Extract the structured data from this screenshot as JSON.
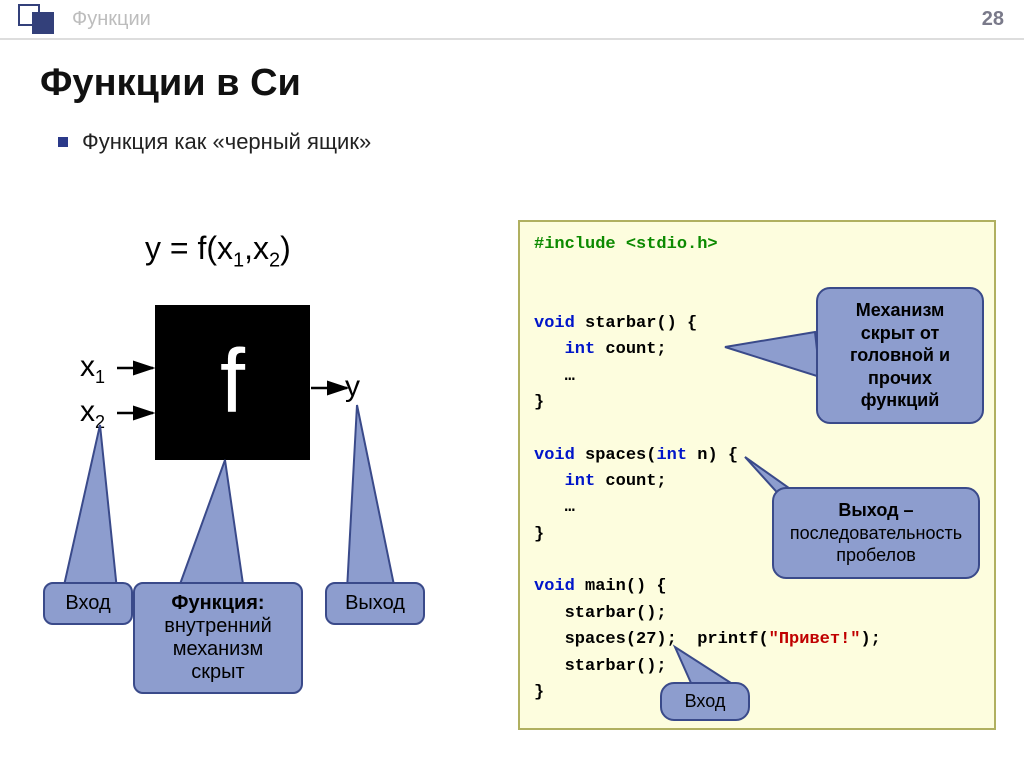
{
  "header": {
    "title": "Функции"
  },
  "page_number": "28",
  "main_title": "Функции в Си",
  "bullet": "Функция как «черный ящик»",
  "formula_html": "y = f(x<sub>1</sub>,x<sub>2</sub>)",
  "x1_html": "x<sub>1</sub>",
  "x2_html": "x<sub>2</sub>",
  "y_label": "y",
  "f_label": "f",
  "callouts": {
    "input": "Вход",
    "function_b": "Функция:",
    "function_rest": "внутренний механизм скрыт",
    "output": "Выход"
  },
  "code": {
    "include": "#include <stdio.h>",
    "l1": "void starbar() {",
    "l2": "   int count;",
    "l3": "   …",
    "l4": "}",
    "l5": "void spaces(int n) {",
    "l6": "   int count;",
    "l7": "   …",
    "l8": "}",
    "l9": "void main() {",
    "l10": "   starbar();",
    "l11a": "   spaces(27);",
    "l11b": "printf(",
    "l11c": "\"Привет!\"",
    "l11d": ");",
    "l12": "   starbar();",
    "l13": "}"
  },
  "code_callouts": {
    "mech": "Механизм скрыт от головной и прочих функций",
    "out_b": "Выход –",
    "out_rest": "последовательность пробелов",
    "in": "Вход"
  }
}
